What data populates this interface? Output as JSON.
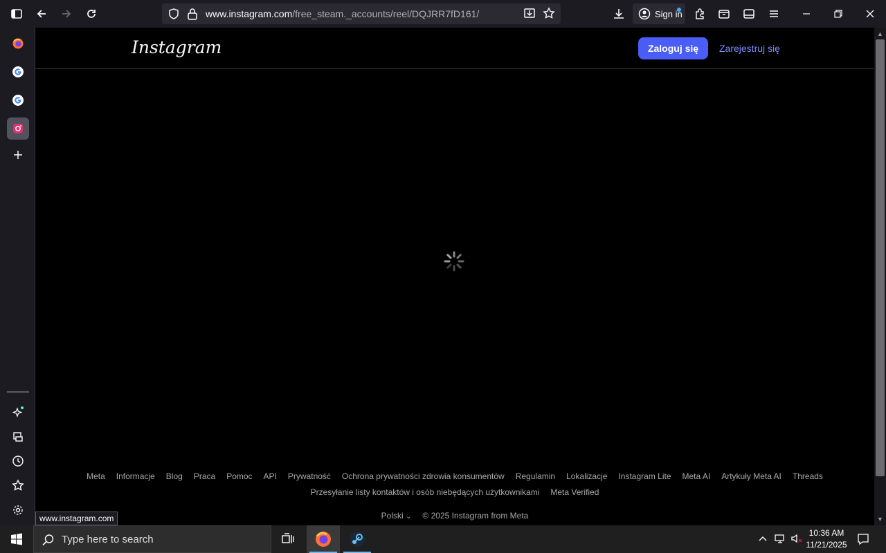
{
  "browser": {
    "url_host": "www.instagram.com",
    "url_path": "/free_steam._accounts/reel/DQJRR7fD161/",
    "signin_label": "Sign in",
    "status_url": "www.instagram.com"
  },
  "page": {
    "logo": "Instagram",
    "login_button": "Zaloguj się",
    "signup_link": "Zarejestruj się",
    "footer_links_row1": [
      "Meta",
      "Informacje",
      "Blog",
      "Praca",
      "Pomoc",
      "API",
      "Prywatność",
      "Ochrona prywatności zdrowia konsumentów",
      "Regulamin",
      "Lokalizacje",
      "Instagram Lite",
      "Meta AI",
      "Artykuły Meta AI",
      "Threads"
    ],
    "footer_links_row2": [
      "Przesyłanie listy kontaktów i osób niebędących użytkownikami",
      "Meta Verified"
    ],
    "language": "Polski",
    "copyright": "© 2025 Instagram from Meta"
  },
  "taskbar": {
    "search_placeholder": "Type here to search",
    "time": "10:36 AM",
    "date": "11/21/2025"
  },
  "colors": {
    "accent_button": "#4a5df9",
    "link": "#7f8bff"
  }
}
